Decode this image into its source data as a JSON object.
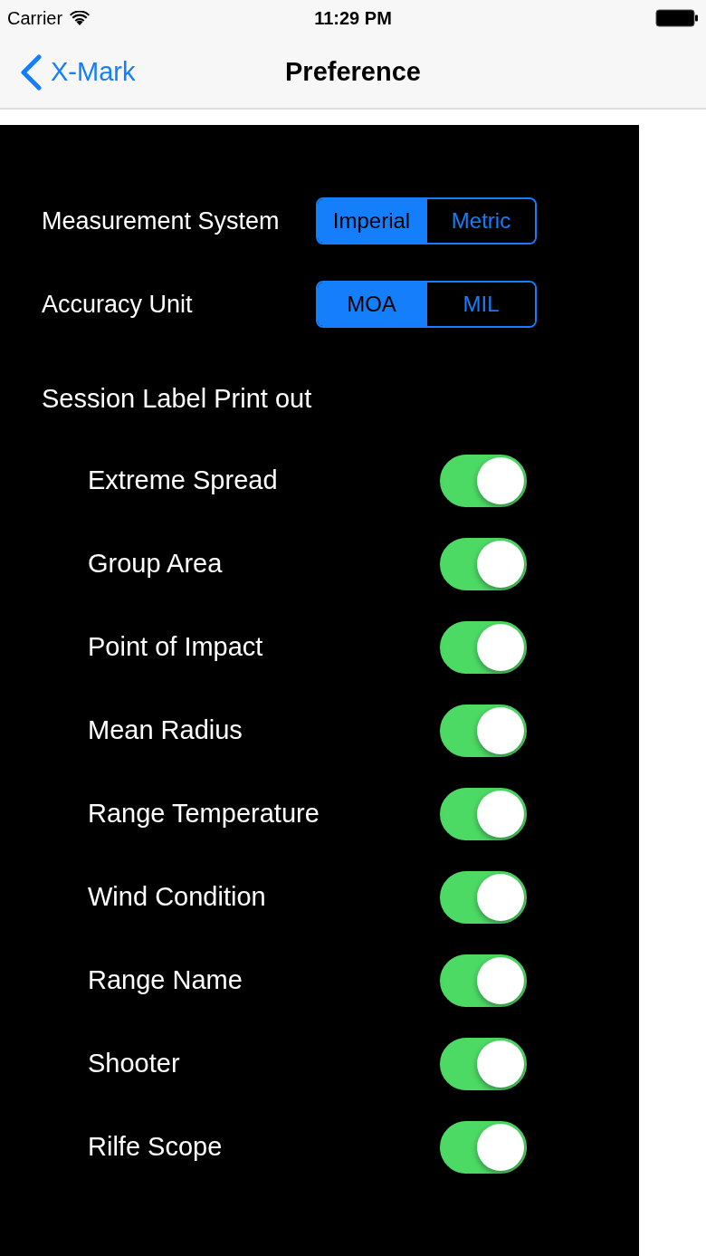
{
  "status_bar": {
    "carrier": "Carrier",
    "time": "11:29 PM"
  },
  "nav_bar": {
    "back_label": "X-Mark",
    "title": "Preference"
  },
  "settings": [
    {
      "label": "Measurement System",
      "options": [
        {
          "label": "Imperial",
          "selected": true
        },
        {
          "label": "Metric",
          "selected": false
        }
      ]
    },
    {
      "label": "Accuracy Unit",
      "options": [
        {
          "label": "MOA",
          "selected": true
        },
        {
          "label": "MIL",
          "selected": false
        }
      ]
    }
  ],
  "print_out": {
    "title": "Session Label Print out",
    "items": [
      {
        "label": "Extreme Spread",
        "on": true
      },
      {
        "label": "Group Area",
        "on": true
      },
      {
        "label": "Point of Impact",
        "on": true
      },
      {
        "label": "Mean Radius",
        "on": true
      },
      {
        "label": "Range Temperature",
        "on": true
      },
      {
        "label": "Wind Condition",
        "on": true
      },
      {
        "label": "Range Name",
        "on": true
      },
      {
        "label": "Shooter",
        "on": true
      },
      {
        "label": "Rilfe Scope",
        "on": true
      }
    ]
  }
}
